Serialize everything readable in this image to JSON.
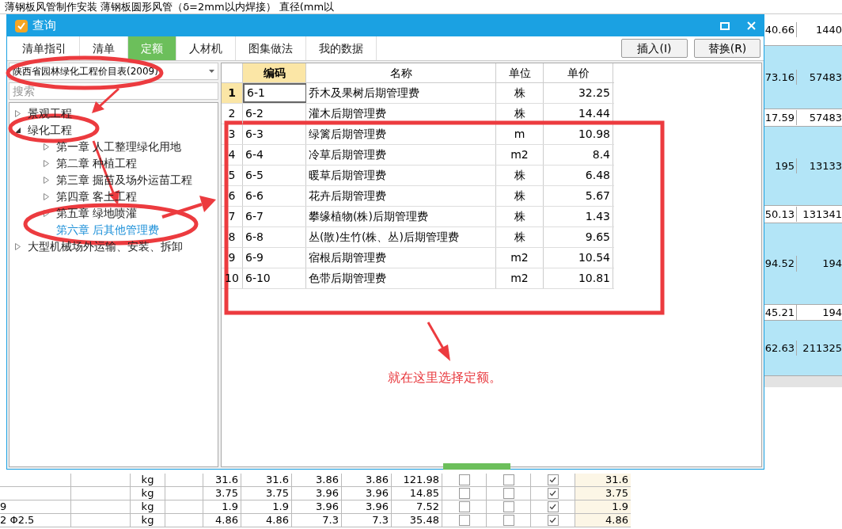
{
  "background_sheet": {
    "top_text": "薄钢板风管制作安装 薄钢板圆形风管（δ=2mm以内焊接） 直径(mm以",
    "right_rows": [
      {
        "kind": "sub",
        "col_1": "40.66",
        "col_2": "1440"
      },
      {
        "kind": "item",
        "col_1": "73.16",
        "col_2": "57483"
      },
      {
        "kind": "sub",
        "col_1": "17.59",
        "col_2": "57483"
      },
      {
        "kind": "item",
        "col_1": "195",
        "col_2": "13133"
      },
      {
        "kind": "sub",
        "col_1": "50.13",
        "col_2": "131341"
      },
      {
        "kind": "item",
        "col_1": "94.52",
        "col_2": "194"
      },
      {
        "kind": "sub",
        "col_1": "45.21",
        "col_2": "194"
      },
      {
        "kind": "item",
        "col_1": "62.63",
        "col_2": "211325"
      }
    ],
    "bottom_rows": [
      {
        "unit": "kg",
        "values": [
          "31.6",
          "31.6",
          "3.86",
          "3.86",
          "121.98"
        ],
        "checks": [
          false,
          false,
          true
        ],
        "total": "31.6"
      },
      {
        "unit": "kg",
        "values": [
          "3.75",
          "3.75",
          "3.96",
          "3.96",
          "14.85"
        ],
        "checks": [
          false,
          false,
          true
        ],
        "total": "3.75"
      },
      {
        "name": "9",
        "unit": "kg",
        "values": [
          "1.9",
          "1.9",
          "3.96",
          "3.96",
          "7.52"
        ],
        "checks": [
          false,
          false,
          true
        ],
        "total": "1.9"
      },
      {
        "name": "2 Φ2.5",
        "unit": "kg",
        "values": [
          "4.86",
          "4.86",
          "7.3",
          "7.3",
          "35.48"
        ],
        "checks": [
          false,
          false,
          true
        ],
        "total": "4.86"
      }
    ]
  },
  "window": {
    "title": "查询"
  },
  "tabs": [
    {
      "label": "清单指引",
      "selected": false
    },
    {
      "label": "清单",
      "selected": false
    },
    {
      "label": "定额",
      "selected": true
    },
    {
      "label": "人材机",
      "selected": false
    },
    {
      "label": "图集做法",
      "selected": false
    },
    {
      "label": "我的数据",
      "selected": false
    }
  ],
  "buttons": [
    "插入(I)",
    "替换(R)"
  ],
  "library_select": {
    "value": "陕西省园林绿化工程价目表(2009)"
  },
  "search": {
    "placeholder": "搜索"
  },
  "tree": [
    {
      "label": "景观工程",
      "expanded": false,
      "selected": false
    },
    {
      "label": "绿化工程",
      "expanded": true,
      "selected": false,
      "children": [
        {
          "label": "第一章 人工整理绿化用地",
          "expanded": false,
          "selected": false
        },
        {
          "label": "第二章 种植工程",
          "expanded": false,
          "selected": false
        },
        {
          "label": "第三章 掘苗及场外运苗工程",
          "expanded": false,
          "selected": false
        },
        {
          "label": "第四章 客土工程",
          "expanded": false,
          "selected": false
        },
        {
          "label": "第五章 绿地喷灌",
          "expanded": false,
          "selected": false
        },
        {
          "label": "第六章 后其他管理费",
          "selected": true
        }
      ]
    },
    {
      "label": "大型机械场外运输、安装、拆卸",
      "expanded": false,
      "selected": false
    }
  ],
  "table": {
    "columns": [
      "编码",
      "名称",
      "单位",
      "单价"
    ],
    "rows": [
      {
        "num": "1",
        "code": "6-1",
        "name": "乔木及果树后期管理费",
        "unit": "株",
        "price": "32.25",
        "selected": true
      },
      {
        "num": "2",
        "code": "6-2",
        "name": "灌木后期管理费",
        "unit": "株",
        "price": "14.44",
        "selected": false
      },
      {
        "num": "3",
        "code": "6-3",
        "name": "绿篱后期管理费",
        "unit": "m",
        "price": "10.98",
        "selected": false
      },
      {
        "num": "4",
        "code": "6-4",
        "name": "冷草后期管理费",
        "unit": "m2",
        "price": "8.4",
        "selected": false
      },
      {
        "num": "5",
        "code": "6-5",
        "name": "暖草后期管理费",
        "unit": "株",
        "price": "6.48",
        "selected": false
      },
      {
        "num": "6",
        "code": "6-6",
        "name": "花卉后期管理费",
        "unit": "株",
        "price": "5.67",
        "selected": false
      },
      {
        "num": "7",
        "code": "6-7",
        "name": "攀缘植物(株)后期管理费",
        "unit": "株",
        "price": "1.43",
        "selected": false
      },
      {
        "num": "8",
        "code": "6-8",
        "name": "丛(散)生竹(株、丛)后期管理费",
        "unit": "株",
        "price": "9.65",
        "selected": false
      },
      {
        "num": "9",
        "code": "6-9",
        "name": "宿根后期管理费",
        "unit": "m2",
        "price": "10.54",
        "selected": false
      },
      {
        "num": "10",
        "code": "6-10",
        "name": "色带后期管理费",
        "unit": "m2",
        "price": "10.81",
        "selected": false
      }
    ]
  },
  "annotation": {
    "caption": "就在这里选择定额。"
  }
}
